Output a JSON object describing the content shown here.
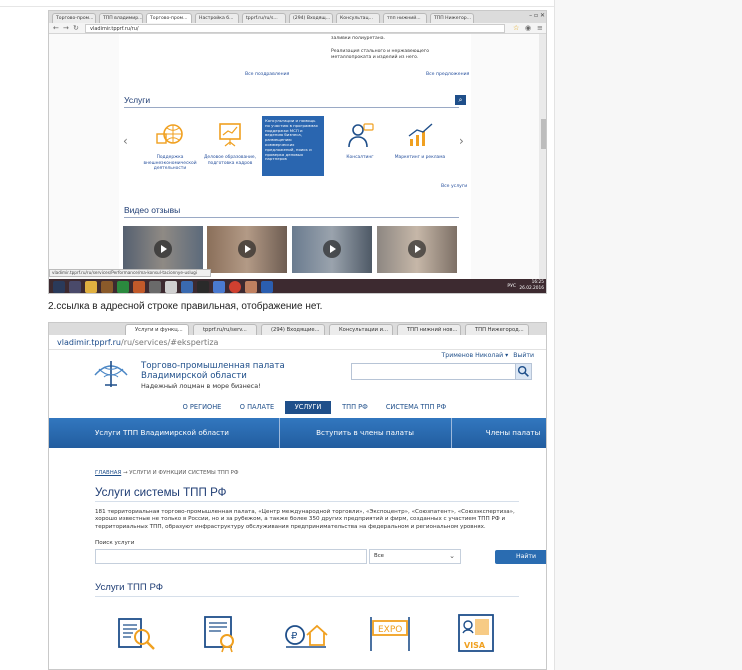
{
  "caption": "2.ссылка в адресной строке правильная, отображение нет.",
  "shot1": {
    "tabs": [
      "Торгово-пром...",
      "ТПП владимир...",
      "Торгово-пром...",
      "Настройка б...",
      "tpprf.ru/ru/s...",
      "(294) Входящ...",
      "Консультац...",
      "тпп нижний...",
      "ТПП Нижегор..."
    ],
    "url": "vladimir.tpprf.ru/ru/",
    "top_texts": [
      "заливки полиуретана.",
      "Реализация стального и нержавеющего металлопроката и изделий из него."
    ],
    "all_congrats": "Все поздравления",
    "all_offers": "Все предложения",
    "services_title": "Услуги",
    "services": [
      {
        "label": "Поддержка внешнеэкономической деятельности"
      },
      {
        "label": "Деловое образование, подготовка кадров"
      },
      {
        "label": "Консультации и помощь по участию в программах поддержки МСП и ведению бизнеса, размещению коммерческих предложений, поиск и проверка деловых партнеров"
      },
      {
        "label": "Консалтинг"
      },
      {
        "label": "Маркетинг и реклама"
      }
    ],
    "all_services": "Все услуги",
    "video_title": "Видео отзывы",
    "status_url": "vladimir.tpprf.ru/ru/services/Performance/ma-konsul-tacionnye-uslugi",
    "tray_lang": "РУС",
    "tray_time": "16:25",
    "tray_date": "26.02.2016",
    "tray_mini": "ENG"
  },
  "shot2": {
    "tabs": [
      "Услуги и функц...",
      "tpprf.ru/ru/serv...",
      "(294) Входящие...",
      "Консультации и...",
      "ТПП нижний нов...",
      "ТПП Нижегород..."
    ],
    "url_main": "vladimir.tpprf.ru",
    "url_rest": "/ru/services/#ekspertiza",
    "org_line1": "Торгово-промышленная палата",
    "org_line2": "Владимирской области",
    "org_tagline": "Надежный лоцман в море бизнеса!",
    "user": "Трименов Николай",
    "logout": "Выйти",
    "menu": [
      "О РЕГИОНЕ",
      "О ПАЛАТЕ",
      "УСЛУГИ",
      "ТПП РФ",
      "СИСТЕМА ТПП РФ"
    ],
    "band": [
      "Услуги ТПП Владимирской области",
      "Вступить в члены палаты",
      "Члены палаты"
    ],
    "crumb_home": "ГЛАВНАЯ",
    "crumb_sep": "→",
    "crumb_current": "УСЛУГИ И ФУНКЦИИ СИСТЕМЫ ТПП РФ",
    "page_title": "Услуги системы ТПП РФ",
    "paragraph": "181 территориальная торгово-промышленная палата, «Центр международной торговли», «Экспоцентр», «Союзпатент», «Союзэкспертиза», хорошо известные не только в России, но и за рубежом, а также более 350 других предприятий и фирм, созданных с участием ТПП РФ и территориальных ТПП, образуют инфраструктуру обслуживания предпринимательства на федеральном и региональном уровнях.",
    "search_label": "Поиск услуги",
    "search_value": "",
    "select_value": "Все",
    "search_button": "Найти",
    "section_title": "Услуги ТПП РФ",
    "expo_label": "EXPO",
    "visa_label": "VISA"
  },
  "colors": {
    "brand_blue": "#1f4f8a",
    "band_blue": "#2a6cb1",
    "icon_orange": "#f0a020",
    "taskbar": "#3d2a30"
  }
}
